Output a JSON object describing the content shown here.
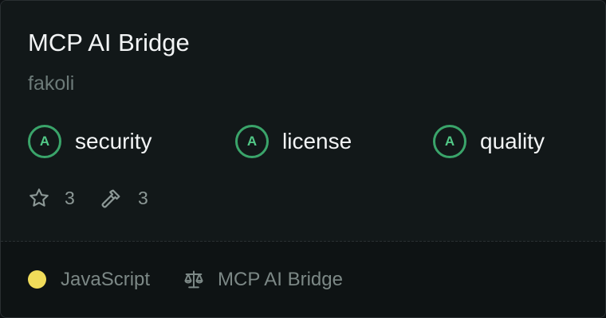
{
  "server": {
    "name": "MCP AI Bridge",
    "owner": "fakoli"
  },
  "scores": [
    {
      "grade": "A",
      "label": "security"
    },
    {
      "grade": "A",
      "label": "license"
    },
    {
      "grade": "A",
      "label": "quality"
    }
  ],
  "stats": {
    "stars": "3",
    "tools": "3"
  },
  "footer": {
    "language": "JavaScript",
    "language_color": "#f0dc5a",
    "license": "MCP AI Bridge"
  },
  "icons": {
    "stars": "star-icon",
    "tools": "hammer-icon",
    "license": "scale-icon"
  },
  "colors": {
    "grade_ring": "#3aa46a",
    "grade_text": "#52c987"
  }
}
